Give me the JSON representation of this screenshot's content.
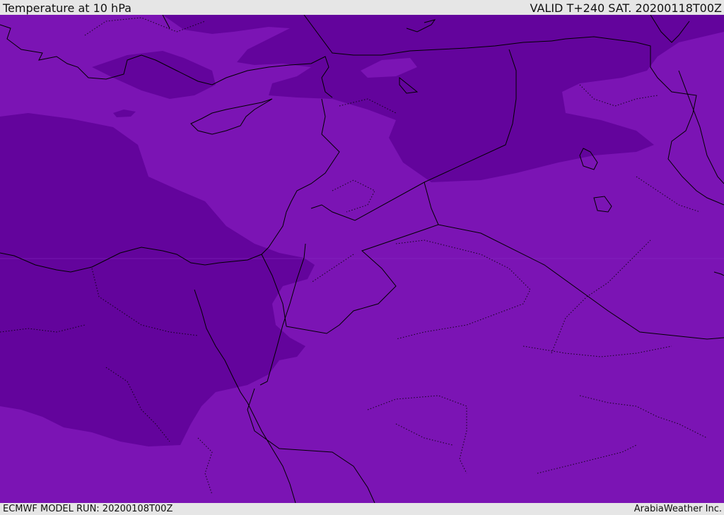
{
  "header": {
    "title": "Temperature at 10 hPa",
    "valid_time": "VALID T+240 SAT. 20200118T00Z"
  },
  "footer": {
    "model_run": "ECMWF MODEL RUN: 20200108T00Z",
    "credit": "ArabiaWeather Inc."
  },
  "colors": {
    "field_light": "#7b14b4",
    "field_dark": "#63049c",
    "coastline": "#000000",
    "border": "#000000"
  }
}
